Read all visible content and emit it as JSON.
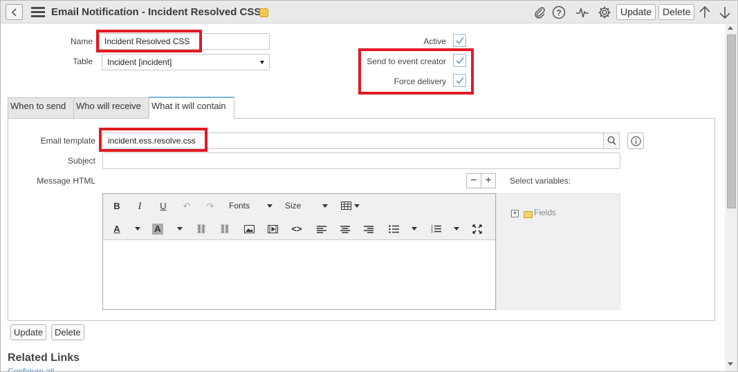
{
  "header": {
    "title": "Email Notification - Incident Resolved CSS",
    "update_label": "Update",
    "delete_label": "Delete"
  },
  "form": {
    "name_label": "Name",
    "name_value": "Incident Resolved CSS",
    "table_label": "Table",
    "table_value": "Incident [incident]",
    "active_label": "Active",
    "active_checked": true,
    "send_to_creator_label": "Send to event creator",
    "send_to_creator_checked": true,
    "force_delivery_label": "Force delivery",
    "force_delivery_checked": true
  },
  "tabs": [
    {
      "label": "When to send",
      "active": false
    },
    {
      "label": "Who will receive",
      "active": false
    },
    {
      "label": "What it will contain",
      "active": true
    }
  ],
  "contents": {
    "email_template_label": "Email template",
    "email_template_value": "incident.ess.resolve.css",
    "subject_label": "Subject",
    "subject_value": "",
    "message_html_label": "Message HTML",
    "select_variables_label": "Select variables:",
    "fonts_label": "Fonts",
    "size_label": "Size",
    "tree_root_label": "Fields"
  },
  "footer": {
    "update_label": "Update",
    "delete_label": "Delete",
    "related_links_heading": "Related Links",
    "related_link_partial": "Configure all"
  },
  "colors": {
    "highlight": "#e01a22",
    "active_tab": "#78b7e3",
    "checkbox_blue": "#5b9bd5"
  }
}
